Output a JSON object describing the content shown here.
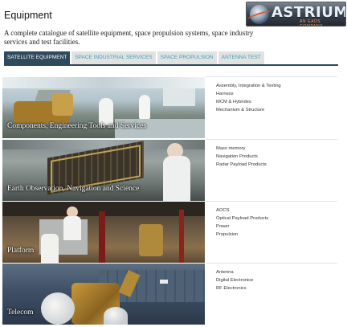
{
  "header": {
    "title": "Equipment",
    "intro": "A complete catalogue of satellite equipment, space propulsion systems, space industry services and test facilities."
  },
  "logo": {
    "wordmark": "ASTRIUM",
    "tagline": "AN EADS COMPANY"
  },
  "tabs": [
    {
      "label": "Satellite Equipment",
      "active": true
    },
    {
      "label": "Space Industrial Services",
      "active": false
    },
    {
      "label": "Space Propulsion",
      "active": false
    },
    {
      "label": "Antenna Test",
      "active": false
    }
  ],
  "categories": [
    {
      "title": "Components, Engineering Tools and Services",
      "links": [
        "Assembly, Integration & Testing",
        "Harness",
        "MCM & Hybrides",
        "Mechanism & Structure"
      ]
    },
    {
      "title": "Earth Observation, Navigation and Science",
      "links": [
        "Mass memory",
        "Navigation Products",
        "Radar Payload Products"
      ]
    },
    {
      "title": "Platform",
      "links": [
        "AOCS",
        "Optical Payload Products",
        "Power",
        "Propulsion"
      ]
    },
    {
      "title": "Telecom",
      "links": [
        "Antenna",
        "Digital Electronice",
        "RF Electronics"
      ]
    }
  ],
  "colors": {
    "active_tab": "#2f4a5d",
    "inactive_tab_text": "#39a0ba",
    "inactive_tab_bg": "#e2e2e2"
  }
}
